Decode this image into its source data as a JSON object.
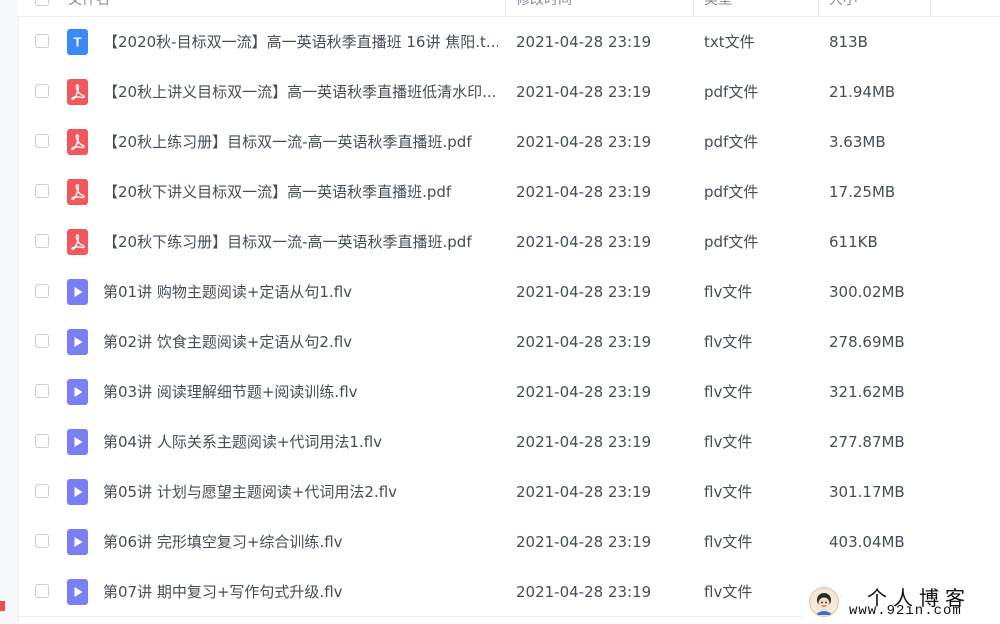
{
  "header": {
    "col_name": "文件名",
    "col_modified": "修改时间",
    "col_type": "类型",
    "col_size": "大小"
  },
  "files": [
    {
      "icon": "txt-file-icon",
      "color": "#3a8bf7",
      "glyph": "T",
      "name": "【2020秋-目标双一流】高一英语秋季直播班 16讲 焦阳.t...",
      "modified": "2021-04-28 23:19",
      "type": "txt文件",
      "size": "813B"
    },
    {
      "icon": "pdf-file-icon",
      "color": "#f2575c",
      "glyph": "",
      "name": "【20秋上讲义目标双一流】高一英语秋季直播班低清水印...",
      "modified": "2021-04-28 23:19",
      "type": "pdf文件",
      "size": "21.94MB"
    },
    {
      "icon": "pdf-file-icon",
      "color": "#f2575c",
      "glyph": "",
      "name": "【20秋上练习册】目标双一流-高一英语秋季直播班.pdf",
      "modified": "2021-04-28 23:19",
      "type": "pdf文件",
      "size": "3.63MB"
    },
    {
      "icon": "pdf-file-icon",
      "color": "#f2575c",
      "glyph": "",
      "name": "【20秋下讲义目标双一流】高一英语秋季直播班.pdf",
      "modified": "2021-04-28 23:19",
      "type": "pdf文件",
      "size": "17.25MB"
    },
    {
      "icon": "pdf-file-icon",
      "color": "#f2575c",
      "glyph": "",
      "name": "【20秋下练习册】目标双一流-高一英语秋季直播班.pdf",
      "modified": "2021-04-28 23:19",
      "type": "pdf文件",
      "size": "611KB"
    },
    {
      "icon": "video-file-icon",
      "color": "#7b7ff6",
      "glyph": "",
      "name": "第01讲 购物主题阅读+定语从句1.flv",
      "modified": "2021-04-28 23:19",
      "type": "flv文件",
      "size": "300.02MB"
    },
    {
      "icon": "video-file-icon",
      "color": "#7b7ff6",
      "glyph": "",
      "name": "第02讲 饮食主题阅读+定语从句2.flv",
      "modified": "2021-04-28 23:19",
      "type": "flv文件",
      "size": "278.69MB"
    },
    {
      "icon": "video-file-icon",
      "color": "#7b7ff6",
      "glyph": "",
      "name": "第03讲 阅读理解细节题+阅读训练.flv",
      "modified": "2021-04-28 23:19",
      "type": "flv文件",
      "size": "321.62MB"
    },
    {
      "icon": "video-file-icon",
      "color": "#7b7ff6",
      "glyph": "",
      "name": "第04讲 人际关系主题阅读+代词用法1.flv",
      "modified": "2021-04-28 23:19",
      "type": "flv文件",
      "size": "277.87MB"
    },
    {
      "icon": "video-file-icon",
      "color": "#7b7ff6",
      "glyph": "",
      "name": "第05讲 计划与愿望主题阅读+代词用法2.flv",
      "modified": "2021-04-28 23:19",
      "type": "flv文件",
      "size": "301.17MB"
    },
    {
      "icon": "video-file-icon",
      "color": "#7b7ff6",
      "glyph": "",
      "name": "第06讲 完形填空复习+综合训练.flv",
      "modified": "2021-04-28 23:19",
      "type": "flv文件",
      "size": "403.04MB"
    },
    {
      "icon": "video-file-icon",
      "color": "#7b7ff6",
      "glyph": "",
      "name": "第07讲 期中复习+写作句式升级.flv",
      "modified": "2021-04-28 23:19",
      "type": "flv文件",
      "size": "..."
    }
  ],
  "watermark": {
    "title": "个人博客",
    "url": "www.92in.com"
  }
}
